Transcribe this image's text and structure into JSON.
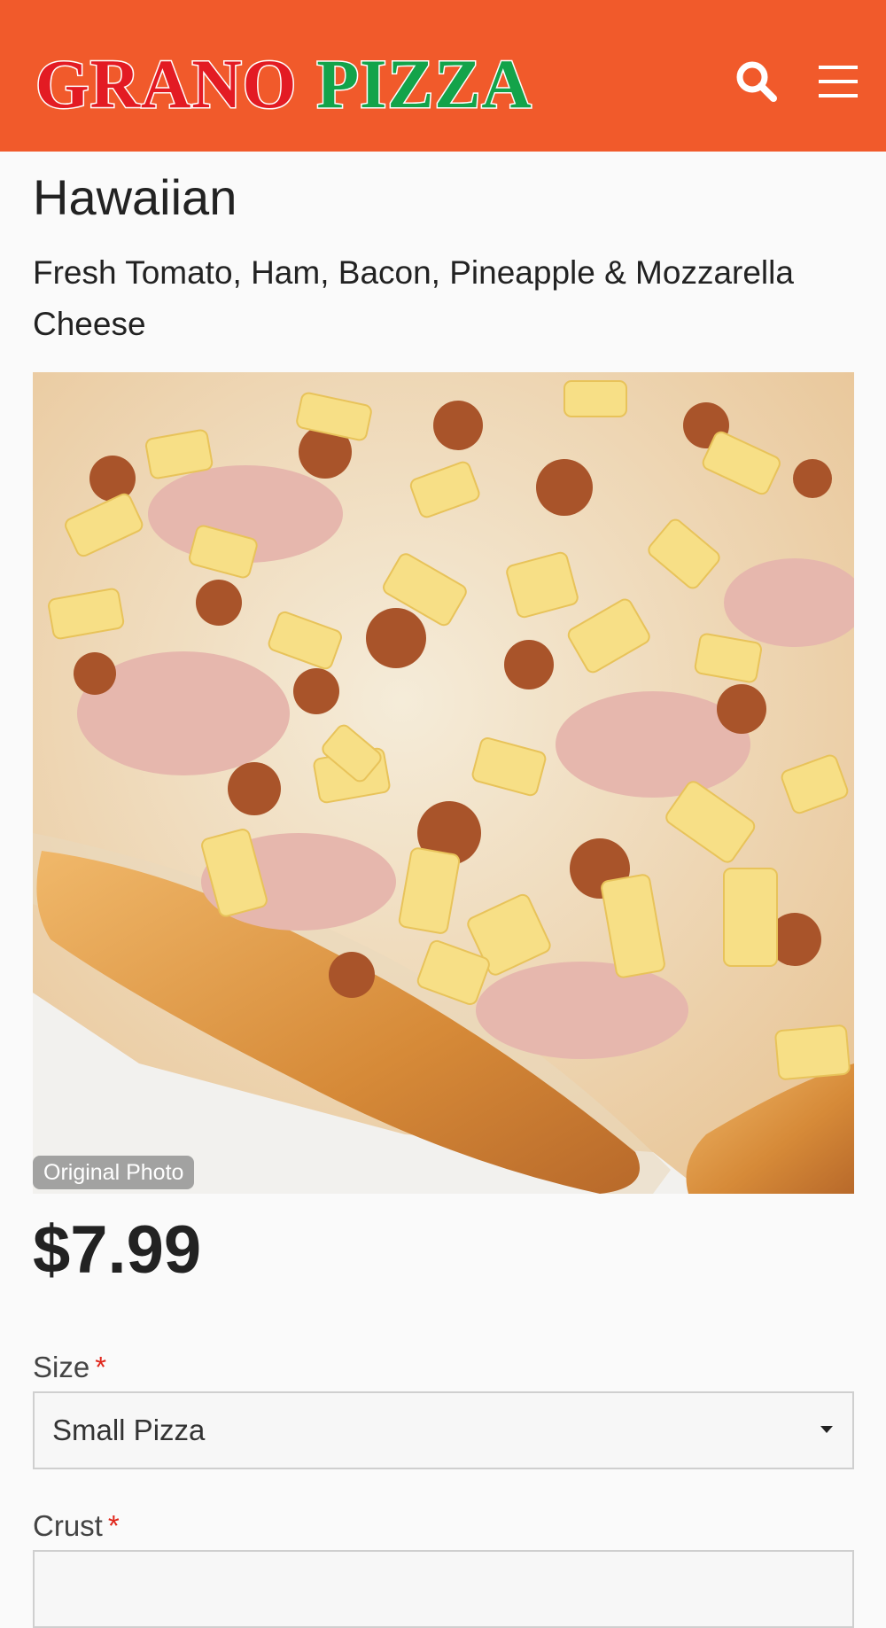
{
  "header": {
    "brand_word_1": "GRANO",
    "brand_word_2": "PIZZA",
    "background_color": "#f15a2b",
    "search_icon": "search-icon",
    "menu_icon": "hamburger-menu-icon"
  },
  "product": {
    "name": "Hawaiian",
    "description": "Fresh Tomato, Ham, Bacon, Pineapple & Mozzarella Cheese",
    "photo_badge": "Original Photo",
    "price": "$7.99"
  },
  "options": {
    "size": {
      "label": "Size",
      "required_mark": "*",
      "selected": "Small Pizza"
    },
    "crust": {
      "label": "Crust",
      "required_mark": "*"
    }
  }
}
